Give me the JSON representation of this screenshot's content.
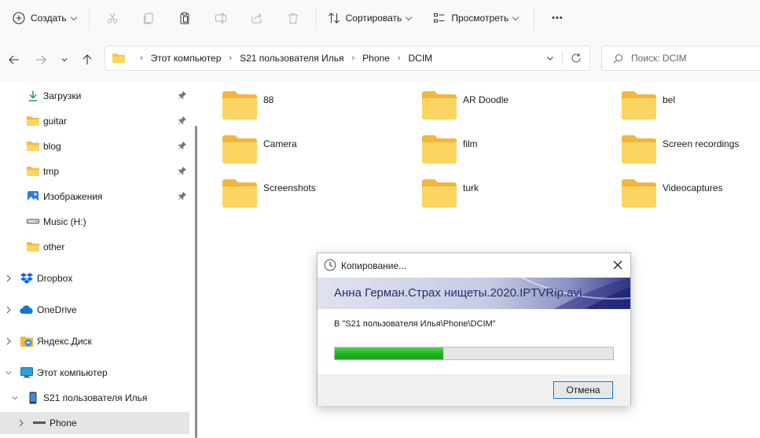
{
  "toolbar": {
    "create_label": "Создать",
    "sort_label": "Сортировать",
    "view_label": "Просмотреть",
    "more_label": "•••"
  },
  "address": {
    "crumbs": [
      "Этот компьютер",
      "S21 пользователя Илья",
      "Phone",
      "DCIM"
    ],
    "sep": "›"
  },
  "search": {
    "placeholder": "Поиск: DCIM"
  },
  "sidebar": {
    "items": [
      {
        "label": "Загрузки",
        "icon": "download-icon",
        "pinned": true
      },
      {
        "label": "guitar",
        "icon": "folder-icon",
        "pinned": true
      },
      {
        "label": "blog",
        "icon": "folder-icon",
        "pinned": true
      },
      {
        "label": "tmp",
        "icon": "folder-icon",
        "pinned": true
      },
      {
        "label": "Изображения",
        "icon": "pictures-icon",
        "pinned": true
      },
      {
        "label": "Music (H:)",
        "icon": "drive-icon",
        "pinned": false
      },
      {
        "label": "other",
        "icon": "folder-icon",
        "pinned": false
      },
      {
        "label": "Dropbox",
        "icon": "dropbox-icon",
        "expandable": true
      },
      {
        "label": "OneDrive",
        "icon": "onedrive-icon",
        "expandable": true
      },
      {
        "label": "Яндекс.Диск",
        "icon": "yandex-disk-icon",
        "expandable": true
      },
      {
        "label": "Этот компьютер",
        "icon": "computer-icon",
        "expanded": true
      },
      {
        "label": "S21 пользователя Илья",
        "icon": "phone-icon",
        "expanded": true
      },
      {
        "label": "Phone",
        "icon": "drive-icon",
        "expandable": true,
        "selected": true
      }
    ]
  },
  "folders": [
    {
      "name": "88"
    },
    {
      "name": "AR Doodle"
    },
    {
      "name": "bel"
    },
    {
      "name": "Camera"
    },
    {
      "name": "film"
    },
    {
      "name": "Screen recordings"
    },
    {
      "name": "Screenshots"
    },
    {
      "name": "turk"
    },
    {
      "name": "Videocaptures"
    }
  ],
  "dialog": {
    "title": "Копирование...",
    "filename": "Анна Герман.Страх нищеты.2020.IPTVRip.avi",
    "destination": "В \"S21 пользователя Илья\\Phone\\DCIM\"",
    "progress": 0.39,
    "cancel_label": "Отмена"
  },
  "colors": {
    "folder": "#f8c44b",
    "accent": "#0067c0",
    "progress": "#23b523"
  }
}
